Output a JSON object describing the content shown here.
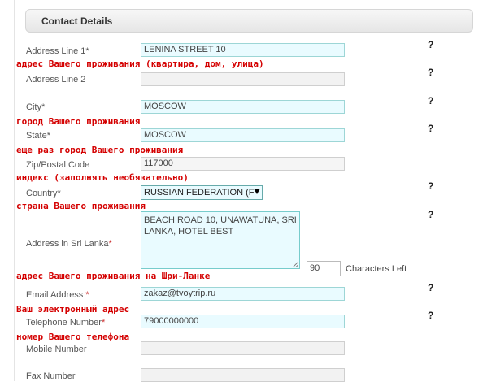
{
  "section": {
    "title": "Contact Details"
  },
  "fields": {
    "address1": {
      "label": "Address Line 1",
      "value": "LENINA STREET 10"
    },
    "address2": {
      "label": "Address Line 2",
      "value": ""
    },
    "city": {
      "label": "City",
      "value": "MOSCOW"
    },
    "state": {
      "label": "State",
      "value": "MOSCOW"
    },
    "zip": {
      "label": "Zip/Postal Code",
      "value": "117000"
    },
    "country": {
      "label": "Country",
      "value": "RUSSIAN FEDERATION (F"
    },
    "srilanka": {
      "label": "Address in Sri Lanka",
      "value": "BEACH ROAD 10, UNAWATUNA, SRI LANKA, HOTEL BEST"
    },
    "email": {
      "label": "Email Address",
      "value": "zakaz@tvoytrip.ru"
    },
    "telephone": {
      "label": "Telephone Number",
      "value": "79000000000"
    },
    "mobile": {
      "label": "Mobile Number",
      "value": ""
    },
    "fax": {
      "label": "Fax Number",
      "value": ""
    }
  },
  "required_marker": "*",
  "counter": {
    "value": "90",
    "label": "Characters Left"
  },
  "help_symbol": "?",
  "notes": {
    "address": "адрес Вашего проживания (квартира, дом, улица)",
    "city": "город Вашего проживания",
    "state": "еще раз город Вашего проживания",
    "zip": "индекс (заполнять необязательно)",
    "country": "страна Вашего проживания",
    "srilanka": "адрес Вашего проживания на Шри-Ланке",
    "email": "Ваш электронный адрес",
    "phone": "номер Вашего телефона"
  }
}
